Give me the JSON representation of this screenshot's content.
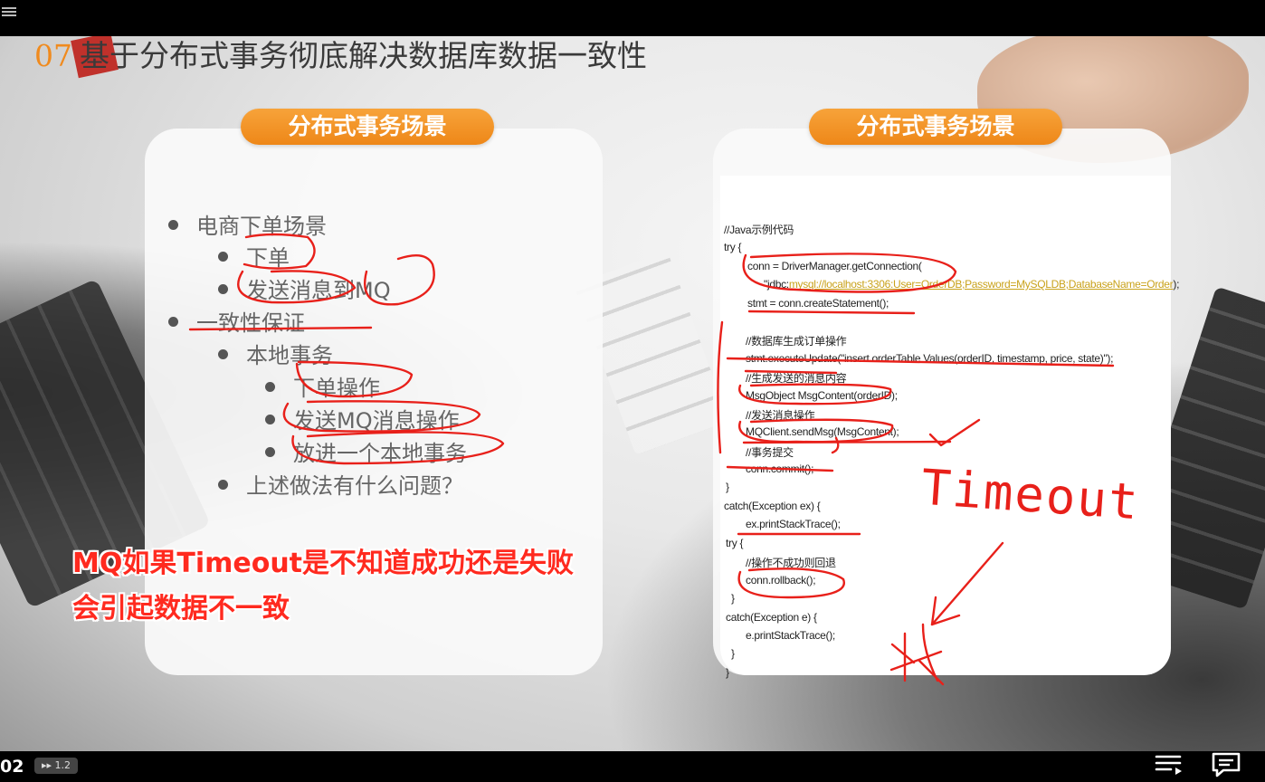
{
  "slide": {
    "number": "07",
    "title": "基于分布式事务彻底解决数据库数据一致性",
    "left_header": "分布式事务场景",
    "right_header": "分布式事务场景",
    "bullets": [
      "电商下单场景",
      "下单",
      "发送消息到MQ",
      "一致性保证",
      "本地事务",
      "下单操作",
      "发送MQ消息操作",
      "放进一个本地事务",
      "上述做法有什么问题？"
    ],
    "code_lines": [
      "//Java示例代码",
      "try {",
      "conn = DriverManager.getConnection(",
      "\"jdbc:",
      "mysql://localhost:3306:User=OrderDB;Password=MySQLDB;DatabaseName=Order",
      ");",
      "stmt = conn.createStatement();",
      "//数据库生成订单操作",
      "stmt.executeUpdate(\"insert orderTable Values(orderID, timestamp, price, state)\");",
      "//生成发送的消息内容",
      "MsgObject MsgContent(orderID);",
      "//发送消息操作",
      "MQClient.sendMsg(MsgContent);",
      "//事务提交",
      "conn.commit();",
      "}",
      "catch(Exception ex)  {",
      "ex.printStackTrace();",
      "try {",
      "//操作不成功则回退",
      "conn.rollback();",
      "}",
      "catch(Exception e) {",
      "e.printStackTrace();",
      "}",
      "}"
    ],
    "annotation": "Timeout"
  },
  "overlay": {
    "line1": "MQ如果Timeout是不知道成功还是失败",
    "line2": "会引起数据不一致"
  },
  "player": {
    "time": "02",
    "speed": "▸▸ 1.2"
  },
  "colors": {
    "accent_orange": "#ee8718",
    "ink_red": "#e8201a",
    "overlay_red": "#ff2a1f"
  }
}
